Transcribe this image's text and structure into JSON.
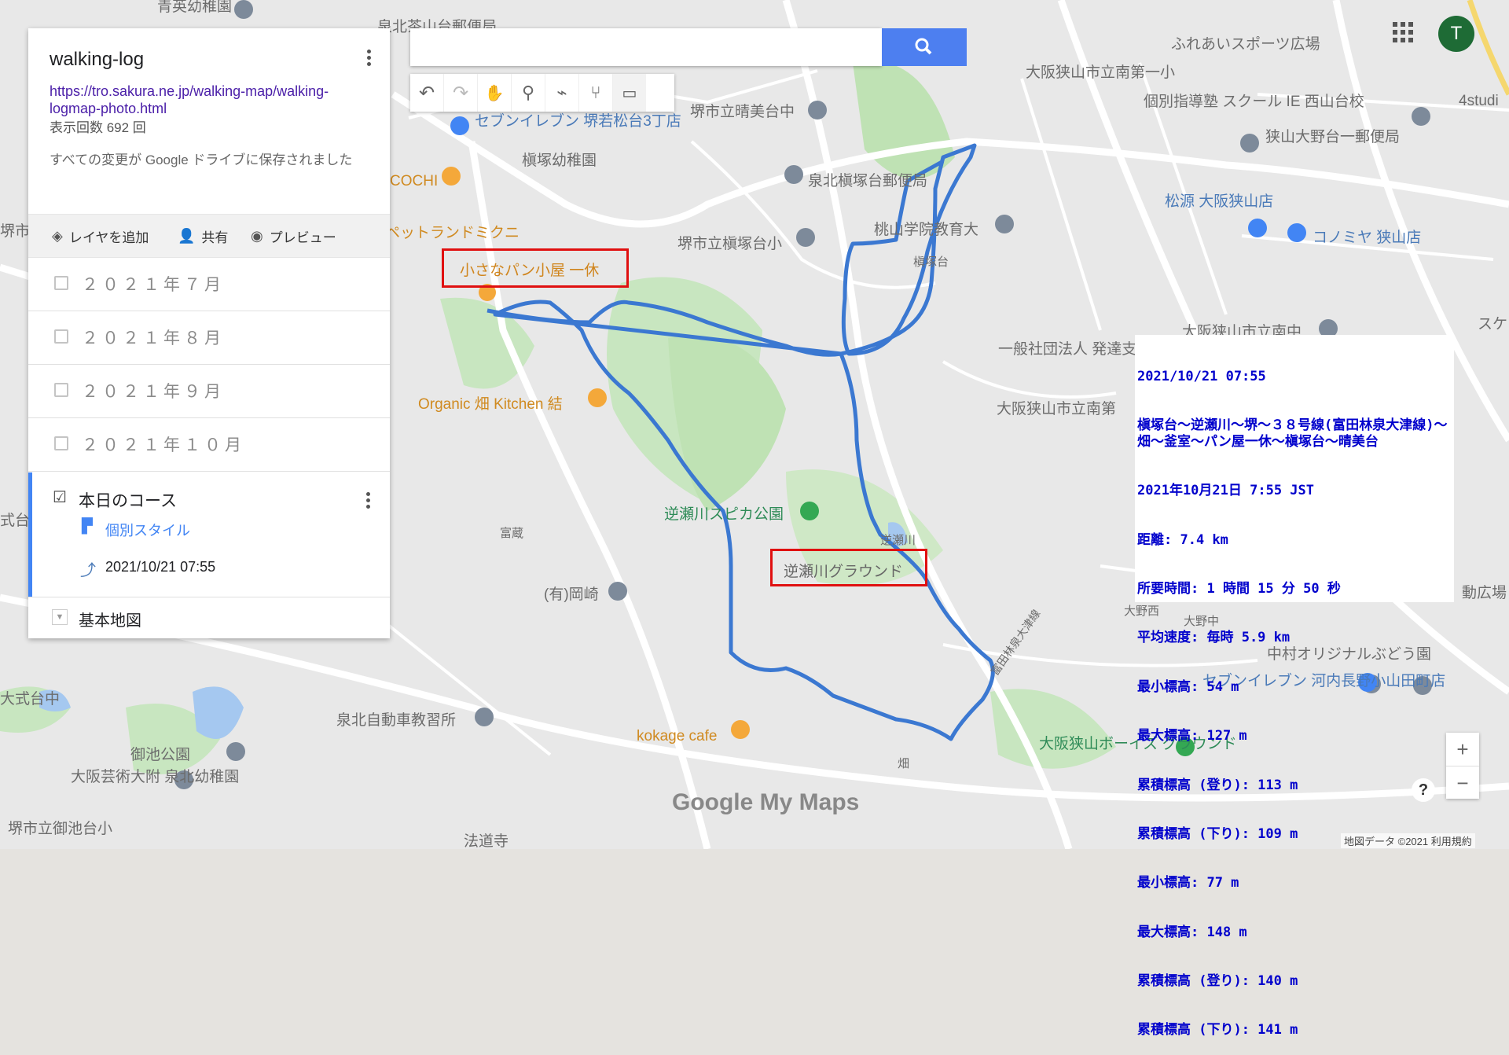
{
  "panel": {
    "title": "walking-log",
    "link": "https://tro.sakura.ne.jp/walking-map/walking-logmap-photo.html",
    "views": "表示回数 692 回",
    "saved": "すべての変更が Google ドライブに保存されました",
    "toolbar": {
      "add_layer": "レイヤを追加",
      "share": "共有",
      "preview": "プレビュー"
    },
    "layers": [
      "２０２１年７月",
      "２０２１年８月",
      "２０２１年９月",
      "２０２１年１０月"
    ],
    "active_layer": {
      "name": "本日のコース",
      "checked": true,
      "style": "個別スタイル",
      "item": "2021/10/21 07:55"
    },
    "basemap": "基本地図"
  },
  "info": {
    "lines": [
      "2021/10/21 07:55",
      "槇塚台～逆瀬川～堺～３８号線(富田林泉大津線)～畑～釜室～パン屋一休～槇塚台～晴美台",
      "2021年10月21日 7:55 JST",
      "距離: 7.4 km",
      "所要時間: 1 時間 15 分 50 秒",
      "平均速度: 毎時 5.9 km",
      "最小標高: 54 m",
      "最大標高: 127 m",
      "累積標高 (登り): 113 m",
      "累積標高 (下り): 109 m",
      "最小標高: 77 m",
      "最大標高: 148 m",
      "累積標高 (登り): 140 m",
      "累積標高 (下り): 141 m"
    ]
  },
  "annotations": {
    "bakery": "小さなパン小屋 一休",
    "ground": "逆瀬川グラウンド"
  },
  "map_labels": [
    "青英幼稚園",
    "泉北茶山台郵便局",
    "ふれあいスポーツ広場",
    "大阪狭山市立南第一小",
    "堺市立晴美台中",
    "セブンイレブン 堺若松台3丁店",
    "個別指導塾 スクール IE 西山台校",
    "狭山大野台一郵便局",
    "槇塚幼稚園",
    "泉北槇塚台郵便局",
    "COCHI",
    "松源 大阪狭山店",
    "コノミヤ 狭山店",
    "堺市立槇塚台小",
    "桃山学院教育大",
    "ペットランドミクニ",
    "槇塚台",
    "大阪狭山市立南中",
    "一般社団法人 発達支援ルームまなび",
    "Organic 畑 Kitchen 結",
    "大阪狭山市立南第",
    "逆瀬川スピカ公園",
    "富蔵",
    "逆瀬川",
    "(有)岡崎",
    "大野西",
    "大野中",
    "中村オリジナルぶどう園",
    "セブンイレブン 河内長野小山田町店",
    "泉北自動車教習所",
    "kokage cafe",
    "御池公園",
    "大阪芸術大附 泉北幼稚園",
    "堺市立御池台小",
    "大阪狭山ボーイズ グラウンド",
    "富田林泉大津線",
    "畑",
    "4studi",
    "スケ ロショ",
    "動広場",
    "大式台中",
    "式台中",
    "堺市立西",
    "法道寺"
  ],
  "attribution": "地図データ ©2021  利用規約",
  "logo": "Google My Maps",
  "avatar": "T"
}
